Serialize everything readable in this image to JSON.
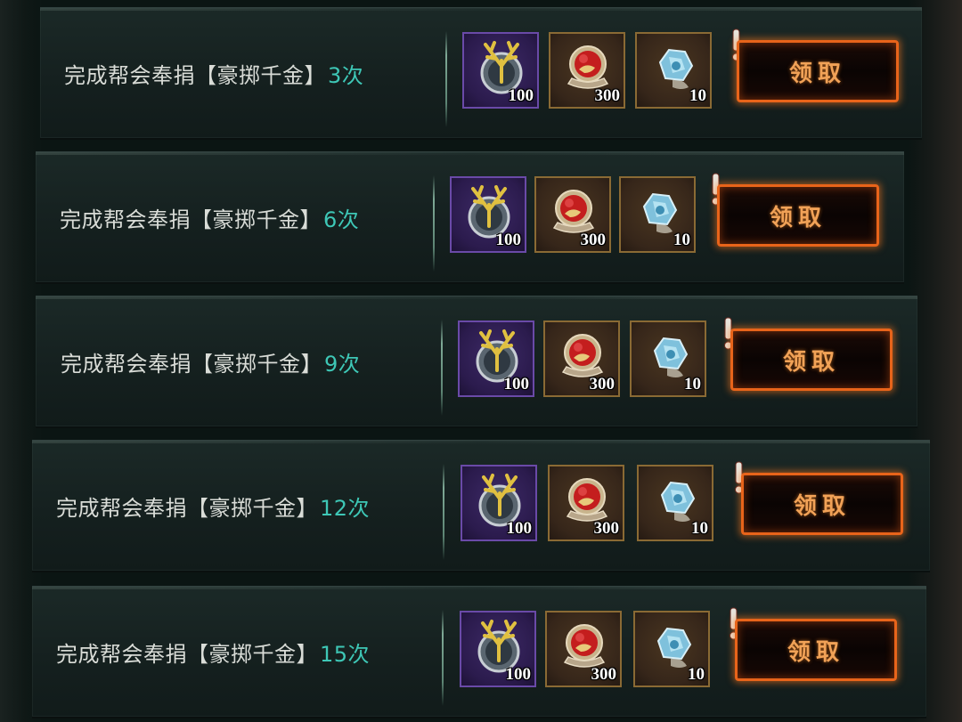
{
  "tasks": [
    {
      "text": "完成帮会奉捐【豪掷千金】",
      "count": "3次",
      "button_label": "领取",
      "rewards": [
        {
          "icon": "antler-emblem-icon",
          "qty": "100",
          "rarity": "purple"
        },
        {
          "icon": "red-lion-medal-icon",
          "qty": "300",
          "rarity": "orange"
        },
        {
          "icon": "blue-crystal-ore-icon",
          "qty": "10",
          "rarity": "orange"
        }
      ]
    },
    {
      "text": "完成帮会奉捐【豪掷千金】",
      "count": "6次",
      "button_label": "领取",
      "rewards": [
        {
          "icon": "antler-emblem-icon",
          "qty": "100",
          "rarity": "purple"
        },
        {
          "icon": "red-lion-medal-icon",
          "qty": "300",
          "rarity": "orange"
        },
        {
          "icon": "blue-crystal-ore-icon",
          "qty": "10",
          "rarity": "orange"
        }
      ]
    },
    {
      "text": "完成帮会奉捐【豪掷千金】",
      "count": "9次",
      "button_label": "领取",
      "rewards": [
        {
          "icon": "antler-emblem-icon",
          "qty": "100",
          "rarity": "purple"
        },
        {
          "icon": "red-lion-medal-icon",
          "qty": "300",
          "rarity": "orange"
        },
        {
          "icon": "blue-crystal-ore-icon",
          "qty": "10",
          "rarity": "orange"
        }
      ]
    },
    {
      "text": "完成帮会奉捐【豪掷千金】",
      "count": "12次",
      "button_label": "领取",
      "rewards": [
        {
          "icon": "antler-emblem-icon",
          "qty": "100",
          "rarity": "purple"
        },
        {
          "icon": "red-lion-medal-icon",
          "qty": "300",
          "rarity": "orange"
        },
        {
          "icon": "blue-crystal-ore-icon",
          "qty": "10",
          "rarity": "orange"
        }
      ]
    },
    {
      "text": "完成帮会奉捐【豪掷千金】",
      "count": "15次",
      "button_label": "领取",
      "rewards": [
        {
          "icon": "antler-emblem-icon",
          "qty": "100",
          "rarity": "purple"
        },
        {
          "icon": "red-lion-medal-icon",
          "qty": "300",
          "rarity": "orange"
        },
        {
          "icon": "blue-crystal-ore-icon",
          "qty": "10",
          "rarity": "orange"
        }
      ]
    }
  ],
  "colors": {
    "count_accent": "#3ec7b6",
    "button_border": "#e8641a",
    "button_text": "#f1a257",
    "rarity_purple": "#6a4aa8",
    "rarity_orange": "#8a6a34"
  }
}
